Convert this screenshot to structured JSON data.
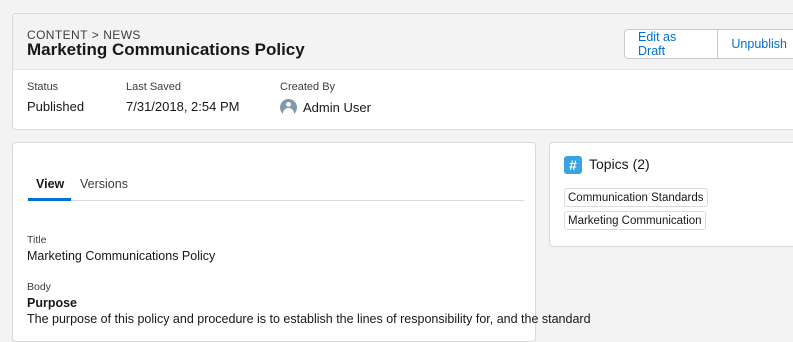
{
  "header": {
    "breadcrumb": [
      "CONTENT",
      "NEWS"
    ],
    "breadcrumb_separator": ">",
    "title": "Marketing Communications Policy",
    "buttons": {
      "edit_draft": "Edit as Draft",
      "unpublish": "Unpublish"
    }
  },
  "fields": {
    "status": {
      "label": "Status",
      "value": "Published"
    },
    "last_saved": {
      "label": "Last Saved",
      "value": "7/31/2018, 2:54 PM"
    },
    "created_by": {
      "label": "Created By",
      "value": "Admin User",
      "icon": "user-avatar-icon"
    }
  },
  "detail": {
    "tabs": [
      "View",
      "Versions"
    ],
    "active_tab": "View",
    "title_label": "Title",
    "title_value": "Marketing Communications Policy",
    "body_label": "Body",
    "body_heading": "Purpose",
    "body_text": "The purpose of this policy and procedure is to establish the lines of responsibility for, and the standard"
  },
  "topics": {
    "icon": "hashtag-icon",
    "icon_glyph": "#",
    "title": "Topics (2)",
    "items": [
      "Communication Standards",
      "Marketing Communication"
    ]
  },
  "colors": {
    "accent": "#0070d2",
    "topic_icon": "#3ba3e1",
    "avatar": "#8199af"
  }
}
